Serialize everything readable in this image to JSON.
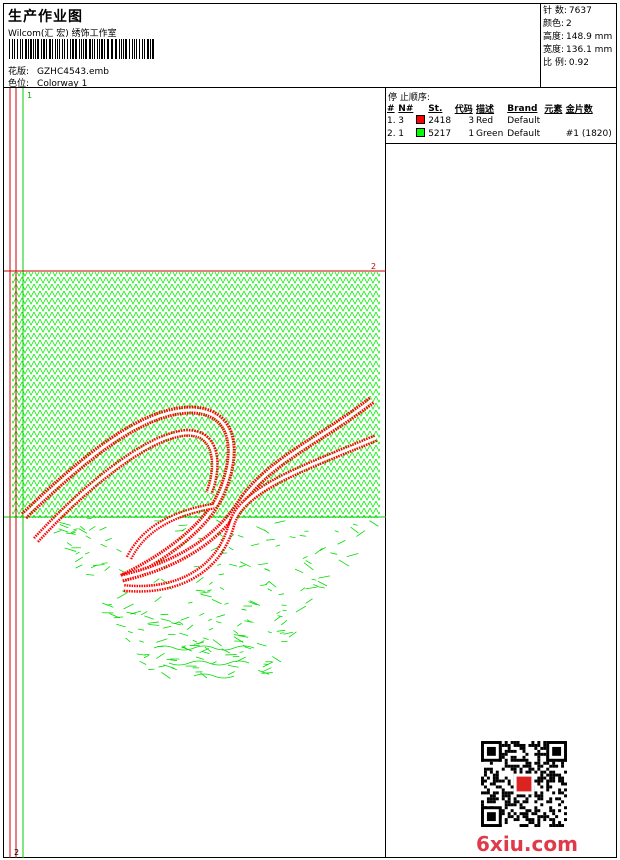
{
  "header": {
    "title": "生产作业图",
    "company": "Wilcom(汇 宏) 绣饰工作室",
    "design_label": "花版:",
    "design_value": "GZHC4543.emb",
    "colorway_label": "色位:",
    "colorway_value": "Colorway 1"
  },
  "stats": {
    "stitches_label": "针 数:",
    "stitches_value": "7637",
    "colors_label": "颜色:",
    "colors_value": "2",
    "height_label": "高度:",
    "height_value": "148.9 mm",
    "width_label": "宽度:",
    "width_value": "136.1 mm",
    "scale_label": "比 例:",
    "scale_value": "0.92"
  },
  "stop_sequence": {
    "title": "停 止顺序:",
    "columns": [
      "#",
      "N#",
      "St.",
      "代码",
      "描述",
      "Brand",
      "元素",
      "金片数"
    ],
    "rows": [
      {
        "idx": "1.",
        "n": "3",
        "color": "#ff0000",
        "st": "2418",
        "code": "3",
        "desc": "Red",
        "brand": "Default",
        "elem": "",
        "seq": ""
      },
      {
        "idx": "2.",
        "n": "1",
        "color": "#00ff00",
        "st": "5217",
        "code": "1",
        "desc": "Green",
        "brand": "Default",
        "elem": "",
        "seq": "#1 (1820)"
      }
    ]
  },
  "canvas": {
    "marker_1": "1",
    "marker_2_right": "2",
    "marker_2_bottom": "2",
    "stitch_green": "#00ff00",
    "stitch_red": "#ff0000",
    "guide_red": "#cc0000"
  },
  "watermark": "6xiu.com"
}
